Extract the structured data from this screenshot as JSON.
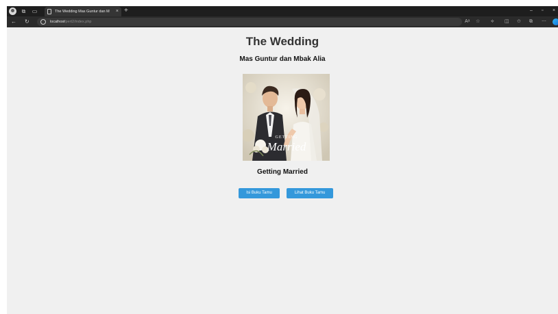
{
  "browser": {
    "tab_title": "The Wedding Mas Guntur dan M",
    "tab_close": "×",
    "new_tab": "+",
    "url_host": "localhost",
    "url_path": "/pert2/index.php",
    "window_controls": {
      "minimize": "–",
      "restore": "▫",
      "close": "×"
    }
  },
  "page": {
    "title": "The Wedding",
    "subtitle": "Mas Guntur dan Mbak Alia",
    "hero_text_small": "GETTING",
    "hero_text_script": "Married",
    "caption": "Getting Married",
    "buttons": {
      "isi_label": "Isi Buku Tamu",
      "lihat_label": "Lihat Buku Tamu"
    }
  },
  "colors": {
    "button": "#3498db",
    "page_bg": "#f0f0f0",
    "title_text": "#333333",
    "chrome_dark": "#1e1e1e"
  }
}
